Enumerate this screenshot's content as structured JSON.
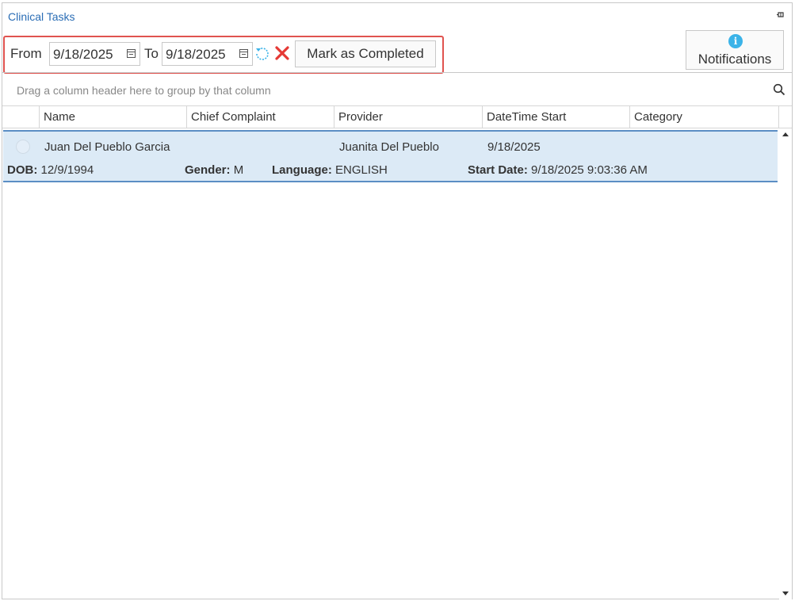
{
  "panel": {
    "title": "Clinical Tasks"
  },
  "toolbar": {
    "from_label": "From",
    "from_date": "9/18/2025",
    "to_label": "To",
    "to_date": "9/18/2025",
    "mark_completed_label": "Mark as Completed",
    "highlight_color": "#e0534f"
  },
  "notifications": {
    "label": "Notifications",
    "icon_glyph": "i",
    "icon_color": "#3bb3e8"
  },
  "grid": {
    "group_hint": "Drag a column header here to group by that column",
    "columns": [
      "Name",
      "Chief Complaint",
      "Provider",
      "DateTime Start",
      "Category"
    ],
    "rows": [
      {
        "name": "Juan Del Pueblo Garcia",
        "chief_complaint": "",
        "provider": "Juanita Del Pueblo",
        "datetime_start": "9/18/2025",
        "category": "",
        "dob_label": "DOB:",
        "dob": "12/9/1994",
        "gender_label": "Gender:",
        "gender": "M",
        "language_label": "Language:",
        "language": "ENGLISH",
        "start_date_label": "Start Date:",
        "start_date": "9/18/2025 9:03:36 AM"
      }
    ],
    "selected_row_color": "#dceaf6"
  }
}
